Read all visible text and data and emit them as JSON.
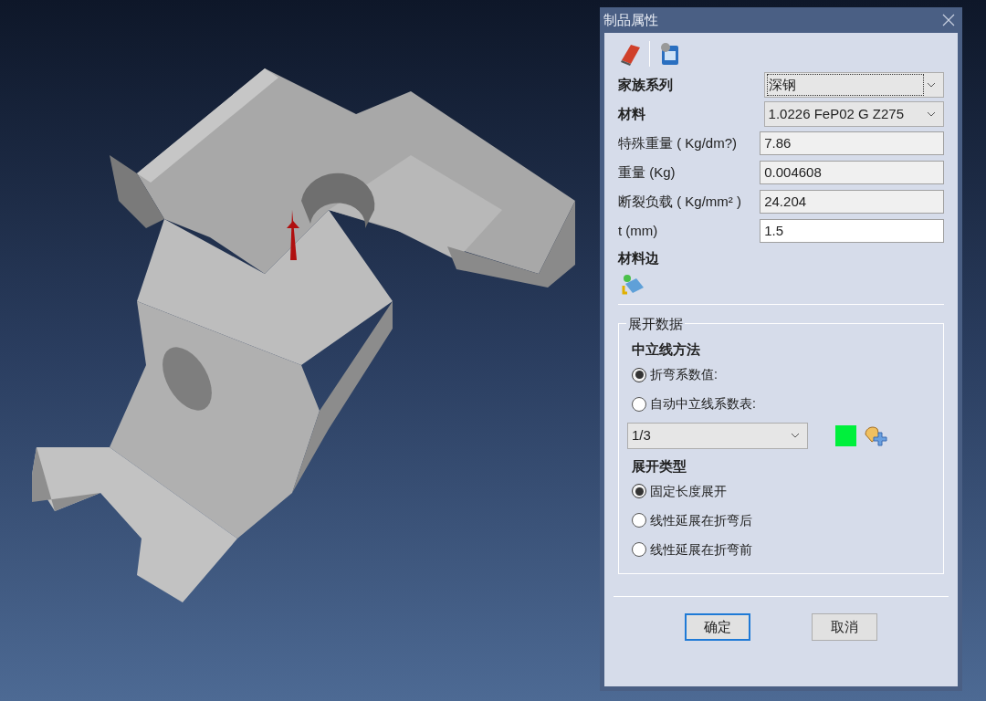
{
  "dialog": {
    "title": "制品属性"
  },
  "properties": [
    {
      "kind": "select",
      "label": "家族系列",
      "value": "深钢",
      "focused": true,
      "bold": true
    },
    {
      "kind": "select",
      "label": "材料",
      "value": "1.0226 FeP02 G Z275",
      "focused": false,
      "bold": true
    },
    {
      "kind": "input",
      "label": "特殊重量 ( Kg/dm?)",
      "value": "7.86",
      "readonly": true,
      "bold": false
    },
    {
      "kind": "input",
      "label": "重量 (Kg)",
      "value": "0.004608",
      "readonly": true,
      "bold": false
    },
    {
      "kind": "input",
      "label": "断裂负载 ( Kg/mm² )",
      "value": "24.204",
      "readonly": true,
      "bold": false
    },
    {
      "kind": "input",
      "label": "t (mm)",
      "value": "1.5",
      "readonly": false,
      "bold": false
    }
  ],
  "material_side": {
    "label": "材料边"
  },
  "unfold": {
    "title": "展开数据",
    "neutral_method": {
      "title": "中立线方法",
      "options": [
        {
          "label": "折弯系数值:",
          "selected": true
        },
        {
          "label": "自动中立线系数表:",
          "selected": false
        }
      ]
    },
    "factor": {
      "value": "1/3",
      "color": "#00f03c"
    },
    "unfold_type": {
      "title": "展开类型",
      "options": [
        {
          "label": "固定长度展开",
          "selected": true
        },
        {
          "label": "线性延展在折弯后",
          "selected": false
        },
        {
          "label": "线性延展在折弯前",
          "selected": false
        }
      ]
    }
  },
  "buttons": [
    {
      "label": "确定",
      "default": true
    },
    {
      "label": "取消",
      "default": false
    }
  ]
}
